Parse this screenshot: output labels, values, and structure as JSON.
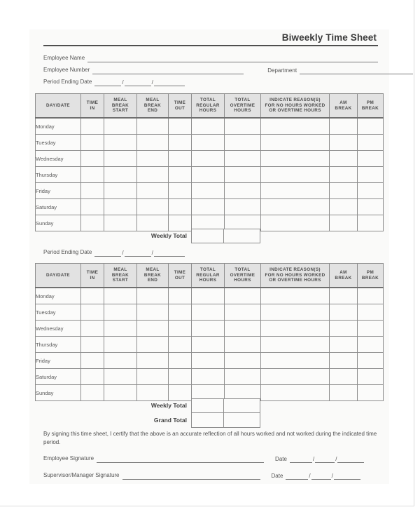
{
  "document": {
    "title": "Biweekly Time Sheet"
  },
  "form_fields": {
    "employee_name_label": "Employee Name",
    "employee_number_label": "Employee Number",
    "department_label": "Department",
    "period_ending_date_label": "Period Ending Date",
    "date_separator": "/"
  },
  "table": {
    "columns": [
      "DAY/DATE",
      "TIME IN",
      "MEAL BREAK START",
      "MEAL BREAK END",
      "TIME OUT",
      "TOTAL REGULAR HOURS",
      "TOTAL OVERTIME HOURS",
      "INDICATE REASON(S) FOR NO HOURS WORKED OR OVERTIME HOURS",
      "AM BREAK",
      "PM BREAK"
    ],
    "column_lines": {
      "day_date": [
        "DAY/DATE"
      ],
      "time_in": [
        "TIME",
        "IN"
      ],
      "meal_break_start": [
        "MEAL",
        "BREAK",
        "START"
      ],
      "meal_break_end": [
        "MEAL",
        "BREAK",
        "END"
      ],
      "time_out": [
        "TIME",
        "OUT"
      ],
      "total_regular_hours": [
        "TOTAL",
        "REGULAR",
        "HOURS"
      ],
      "total_overtime_hours": [
        "TOTAL",
        "OVERTIME",
        "HOURS"
      ],
      "reason": [
        "INDICATE REASON(S)",
        "FOR NO HOURS WORKED",
        "OR OVERTIME HOURS"
      ],
      "am_break": [
        "AM",
        "BREAK"
      ],
      "pm_break": [
        "PM",
        "BREAK"
      ]
    },
    "days": [
      "Monday",
      "Tuesday",
      "Wednesday",
      "Thursday",
      "Friday",
      "Saturday",
      "Sunday"
    ]
  },
  "totals": {
    "weekly_total_label": "Weekly Total",
    "grand_total_label": "Grand Total"
  },
  "certification": {
    "text": "By signing this time sheet, I certify that the above is an accurate reflection of all hours worked and not worked during the indicated time period.",
    "employee_signature_label": "Employee Signature",
    "supervisor_signature_label": "Supervisor/Manager Signature",
    "date_label": "Date",
    "date_separator": "/"
  },
  "colors": {
    "page_background": "#ffffff",
    "sheet_background": "#fafaf9",
    "header_fill": "#e2e2e2",
    "border": "#8d8d8d",
    "text": "#4a4a4a",
    "title_rule": "#4f4f4f"
  }
}
